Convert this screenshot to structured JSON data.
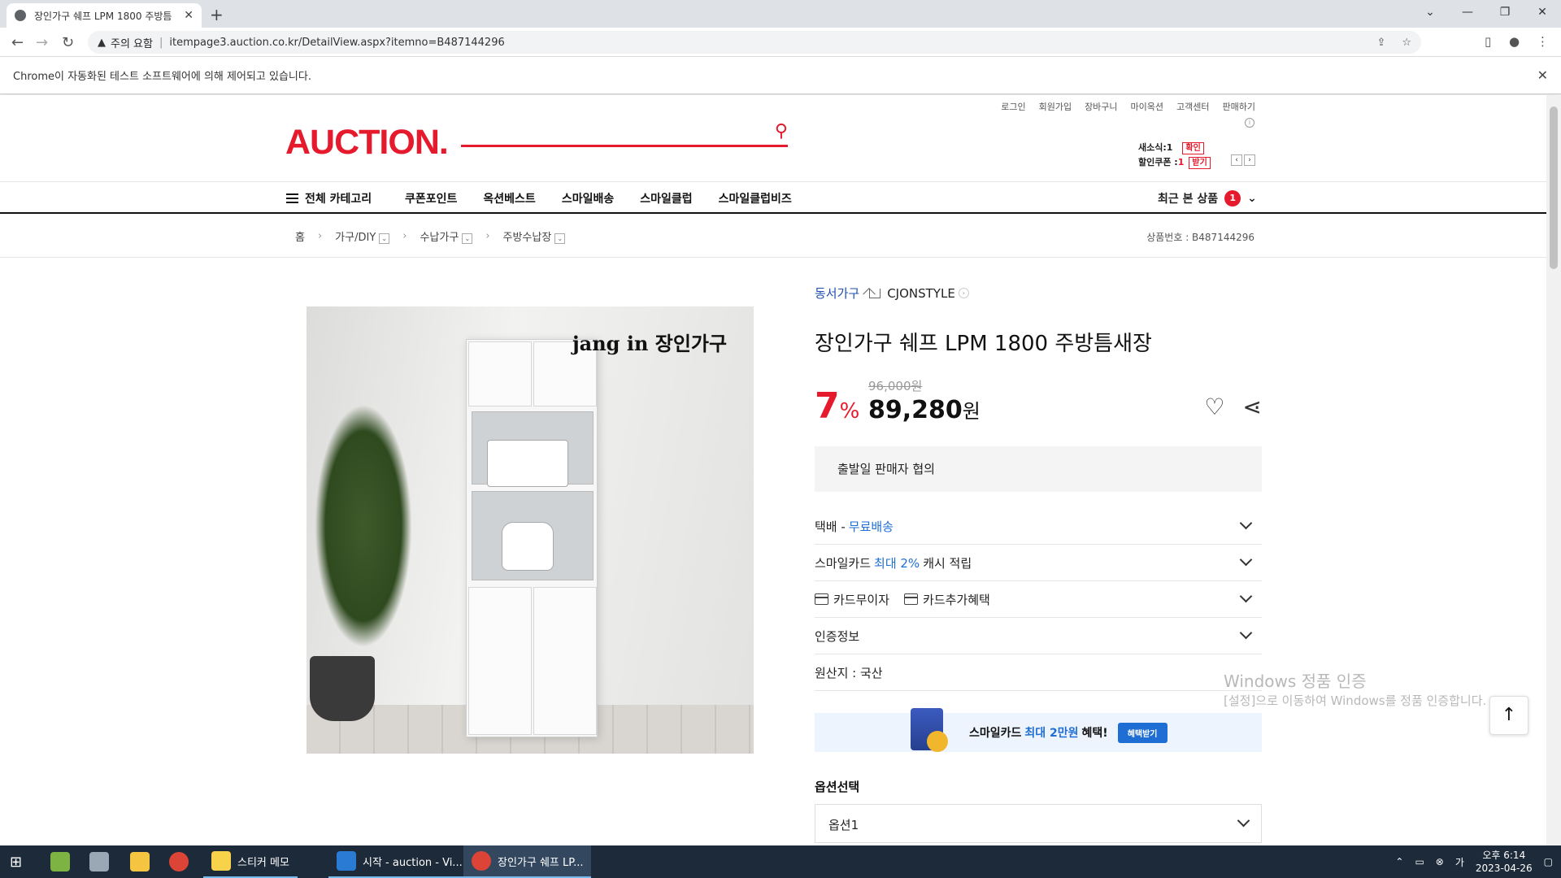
{
  "browser": {
    "tab_title": "장인가구 쉐프 LPM 1800 주방틈",
    "warning": "주의 요함",
    "url": "itempage3.auction.co.kr/DetailView.aspx?itemno=B487144296",
    "infobar": "Chrome이 자동화된 테스트 소프트웨어에 의해 제어되고 있습니다."
  },
  "header": {
    "links": [
      "로그인",
      "회원가입",
      "장바구니",
      "마이옥션",
      "고객센터",
      "판매하기"
    ],
    "logo": "AUCTION.",
    "mini": {
      "new_msg_label": "새소식:",
      "new_msg_count": "1",
      "new_msg_btn": "확인",
      "coupon_label": "할인쿠폰 :",
      "coupon_count": "1",
      "coupon_btn": "받기"
    }
  },
  "gnb": {
    "all_category": "전체 카테고리",
    "menu": [
      "쿠폰포인트",
      "옥션베스트",
      "스마일배송",
      "스마일클럽",
      "스마일클럽비즈"
    ],
    "recent_label": "최근 본 상품",
    "recent_count": "1"
  },
  "breadcrumb": {
    "home": "홈",
    "items": [
      "가구/DIY",
      "수납가구",
      "주방수납장"
    ],
    "product_no": "상품번호 : B487144296"
  },
  "product": {
    "image_brand": "jang in 장인가구",
    "category": "동서가구",
    "store": "CJONSTYLE",
    "title": "장인가구 쉐프 LPM 1800 주방틈새장",
    "discount": "7",
    "discount_unit": "%",
    "original_price": "96,000원",
    "sale_price": "89,280",
    "sale_unit": "원",
    "shipping_note": "출발일 판매자 협의",
    "rows": {
      "delivery_label": "택배 -",
      "delivery_value": "무료배송",
      "smilecard_a": "스마일카드",
      "smilecard_b": "최대 2%",
      "smilecard_c": "캐시 적립",
      "installment": "카드무이자",
      "card_benefit": "카드추가혜택",
      "certification": "인증정보",
      "origin": "원산지 : 국산"
    },
    "banner": {
      "a": "스마일카드",
      "b": "최대 2만원",
      "c": "혜택!",
      "btn": "혜택받기"
    },
    "option_title": "옵션선택",
    "option_value": "옵션1"
  },
  "watermark": {
    "line1": "Windows 정품 인증",
    "line2": "[설정]으로 이동하여 Windows를 정품 인증합니다."
  },
  "taskbar": {
    "apps": [
      "스티커 메모",
      "시작 - auction - Vi...",
      "장인가구 쉐프 LP..."
    ],
    "time": "오후 6:14",
    "date": "2023-04-26"
  }
}
